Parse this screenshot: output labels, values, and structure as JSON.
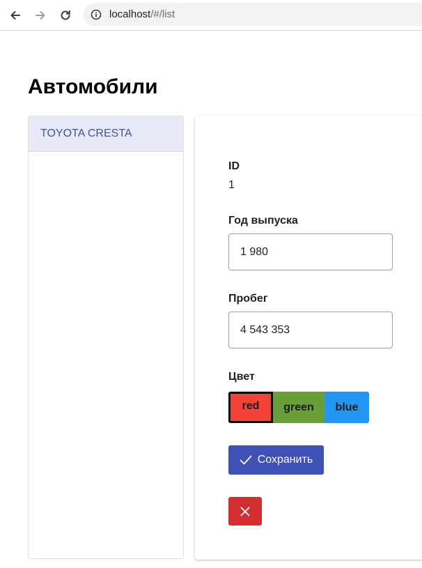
{
  "browser": {
    "url_host": "localhost",
    "url_path": "/#/list"
  },
  "page": {
    "title": "Автомобили"
  },
  "list": {
    "items": [
      {
        "label": "TOYOTA CRESTA"
      }
    ]
  },
  "detail": {
    "id_label": "ID",
    "id_value": "1",
    "year_label": "Год выпуска",
    "year_value": "1 980",
    "mileage_label": "Пробег",
    "mileage_value": "4 543 353",
    "color_label": "Цвет",
    "color_options": [
      "red",
      "green",
      "blue"
    ],
    "selected_color": "red",
    "save_label": "Сохранить"
  },
  "colors": {
    "primary": "#3f51b5",
    "danger": "#d32f2f",
    "red": "#f44336",
    "green": "#689f38",
    "blue": "#2196f3",
    "selected_item_bg": "#e8eaf6"
  },
  "icons": {
    "back": "arrow-left-icon",
    "forward": "arrow-right-icon",
    "reload": "reload-icon",
    "site_info": "info-icon",
    "save": "check-icon",
    "delete": "close-icon"
  }
}
